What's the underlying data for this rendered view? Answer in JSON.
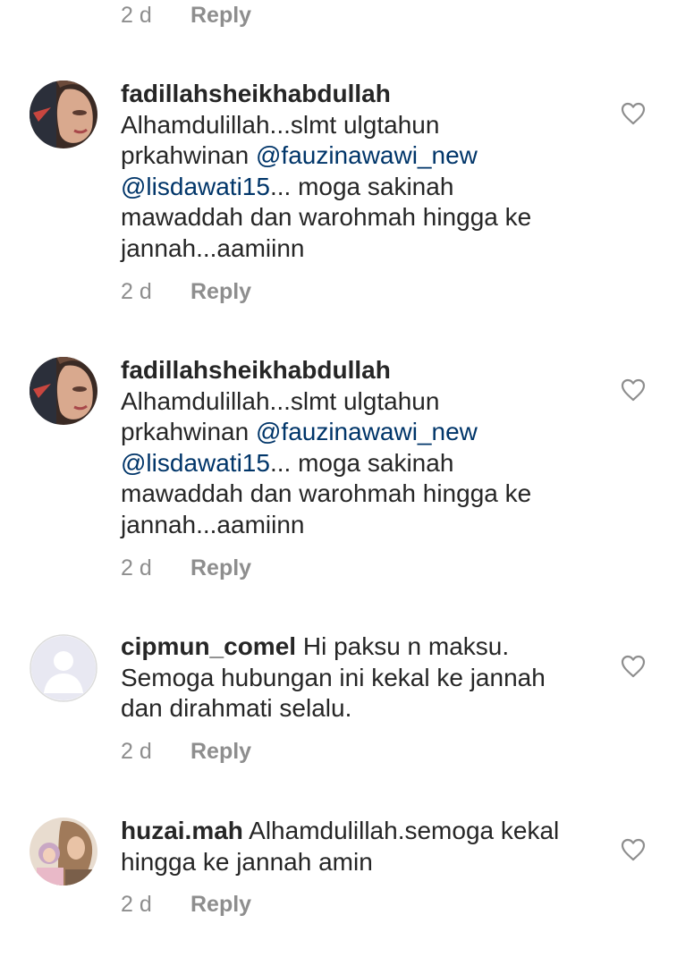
{
  "top_meta": {
    "time": "2 d",
    "reply": "Reply"
  },
  "comments": [
    {
      "username": "fadillahsheikhabdullah",
      "lines": [
        "Alhamdulillah...slmt ulgtahun"
      ],
      "line2_prefix": "prkahwinan ",
      "mention1": "@fauzinawawi_new",
      "mention2": "@lisdawati15",
      "line3_suffix": "... moga sakinah",
      "line4": "mawaddah dan warohmah hingga ke",
      "line5": "jannah...aamiinn",
      "time": "2 d",
      "reply": "Reply"
    },
    {
      "username": "fadillahsheikhabdullah",
      "lines": [
        "Alhamdulillah...slmt ulgtahun"
      ],
      "line2_prefix": "prkahwinan ",
      "mention1": "@fauzinawawi_new",
      "mention2": "@lisdawati15",
      "line3_suffix": "... moga sakinah",
      "line4": "mawaddah dan warohmah hingga ke",
      "line5": "jannah...aamiinn",
      "time": "2 d",
      "reply": "Reply"
    },
    {
      "username": "cipmun_comel",
      "text": "Hi paksu n maksu.",
      "line2": "Semoga hubungan ini kekal ke jannah",
      "line3": "dan dirahmati selalu.",
      "time": "2 d",
      "reply": "Reply"
    },
    {
      "username": "huzai.mah",
      "text": "Alhamdulillah.semoga kekal",
      "line2": "hingga ke jannah amin",
      "time": "2 d",
      "reply": "Reply"
    }
  ],
  "icons": {
    "like": "heart-outline-icon",
    "avatar_default": "default-user-avatar-icon"
  },
  "colors": {
    "text": "#262626",
    "muted": "#8e8e8e",
    "mention": "#003569"
  }
}
